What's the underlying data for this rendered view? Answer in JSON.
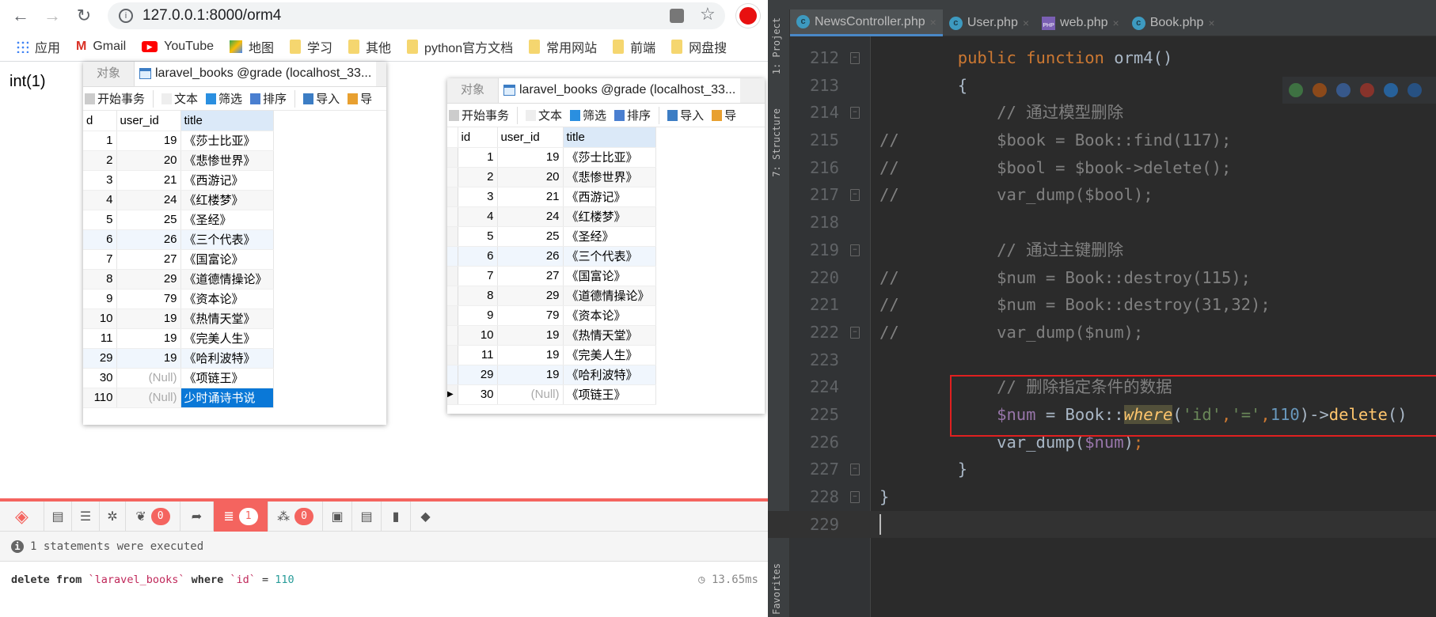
{
  "browser": {
    "url": "127.0.0.1:8000/orm4",
    "bookmarks": [
      "应用",
      "Gmail",
      "YouTube",
      "地图",
      "学习",
      "其他",
      "python官方文档",
      "常用网站",
      "前端",
      "网盘搜"
    ],
    "page_output": "int(1)"
  },
  "navicat_before": {
    "tab_objects": "对象",
    "tab_table": "laravel_books @grade (localhost_33...",
    "tools": {
      "begin": "开始事务",
      "text": "文本",
      "filter": "筛选",
      "sort": "排序",
      "import": "导入",
      "export": "导"
    },
    "columns": [
      "d",
      "user_id",
      "title"
    ],
    "rows": [
      [
        "1",
        "19",
        "《莎士比亚》"
      ],
      [
        "2",
        "20",
        "《悲惨世界》"
      ],
      [
        "3",
        "21",
        "《西游记》"
      ],
      [
        "4",
        "24",
        "《红楼梦》"
      ],
      [
        "5",
        "25",
        "《圣经》"
      ],
      [
        "6",
        "26",
        "《三个代表》"
      ],
      [
        "7",
        "27",
        "《国富论》"
      ],
      [
        "8",
        "29",
        "《道德情操论》"
      ],
      [
        "9",
        "79",
        "《资本论》"
      ],
      [
        "10",
        "19",
        "《热情天堂》"
      ],
      [
        "11",
        "19",
        "《完美人生》"
      ],
      [
        "29",
        "19",
        "《哈利波特》"
      ],
      [
        "30",
        "(Null)",
        "《项链王》"
      ],
      [
        "110",
        "(Null)",
        "少时诵诗书说"
      ]
    ]
  },
  "navicat_after": {
    "tab_objects": "对象",
    "tab_table": "laravel_books @grade (localhost_33...",
    "tools": {
      "begin": "开始事务",
      "text": "文本",
      "filter": "筛选",
      "sort": "排序",
      "import": "导入",
      "export": "导"
    },
    "columns": [
      "id",
      "user_id",
      "title"
    ],
    "rows": [
      [
        "1",
        "19",
        "《莎士比亚》"
      ],
      [
        "2",
        "20",
        "《悲惨世界》"
      ],
      [
        "3",
        "21",
        "《西游记》"
      ],
      [
        "4",
        "24",
        "《红楼梦》"
      ],
      [
        "5",
        "25",
        "《圣经》"
      ],
      [
        "6",
        "26",
        "《三个代表》"
      ],
      [
        "7",
        "27",
        "《国富论》"
      ],
      [
        "8",
        "29",
        "《道德情操论》"
      ],
      [
        "9",
        "79",
        "《资本论》"
      ],
      [
        "10",
        "19",
        "《热情天堂》"
      ],
      [
        "11",
        "19",
        "《完美人生》"
      ],
      [
        "29",
        "19",
        "《哈利波特》"
      ],
      [
        "30",
        "(Null)",
        "《项链王》"
      ]
    ]
  },
  "debugbar": {
    "badges": {
      "messages": "0",
      "queries": "1",
      "models": "0"
    },
    "status": "1 statements were executed",
    "query": {
      "kw1": "delete from ",
      "table": "`laravel_books`",
      "kw2": " where ",
      "col": "`id`",
      "op": " = ",
      "val": "110"
    },
    "time": "13.65ms",
    "accent": "#f4645f"
  },
  "ide": {
    "side_labels": [
      "1: Project",
      "7: Structure",
      "Favorites"
    ],
    "tabs": [
      "NewsController.php",
      "User.php",
      "web.php",
      "Book.php"
    ],
    "lines": [
      {
        "n": "212",
        "tokens": [
          [
            "        ",
            "d"
          ],
          [
            "public ",
            "k"
          ],
          [
            "function ",
            "k"
          ],
          [
            "orm4",
            "fn"
          ],
          [
            "()",
            "d"
          ]
        ]
      },
      {
        "n": "213",
        "tokens": [
          [
            "        {",
            "d"
          ]
        ]
      },
      {
        "n": "214",
        "tokens": [
          [
            "            // 通过模型删除",
            "c"
          ]
        ]
      },
      {
        "n": "215",
        "tokens": [
          [
            "//          $book = Book::find(117);",
            "c"
          ]
        ]
      },
      {
        "n": "216",
        "tokens": [
          [
            "//          $bool = $book->delete();",
            "c"
          ]
        ]
      },
      {
        "n": "217",
        "tokens": [
          [
            "//          var_dump($bool);",
            "c"
          ]
        ]
      },
      {
        "n": "218",
        "tokens": []
      },
      {
        "n": "219",
        "tokens": [
          [
            "            // 通过主键删除",
            "c"
          ]
        ]
      },
      {
        "n": "220",
        "tokens": [
          [
            "//          $num = Book::destroy(115);",
            "c"
          ]
        ]
      },
      {
        "n": "221",
        "tokens": [
          [
            "//          $num = Book::destroy(31,32);",
            "c"
          ]
        ]
      },
      {
        "n": "222",
        "tokens": [
          [
            "//          var_dump($num);",
            "c"
          ]
        ]
      },
      {
        "n": "223",
        "tokens": []
      },
      {
        "n": "224",
        "tokens": [
          [
            "            // 删除指定条件的数据",
            "c"
          ]
        ]
      },
      {
        "n": "225",
        "tokens": [
          [
            "            ",
            "d"
          ],
          [
            "$num",
            "v"
          ],
          [
            " = Book::",
            "d"
          ],
          [
            "where",
            "hl-w"
          ],
          [
            "(",
            "d"
          ],
          [
            "'id'",
            "s"
          ],
          [
            ",",
            "k"
          ],
          [
            "'='",
            "s"
          ],
          [
            ",",
            "k"
          ],
          [
            "110",
            "n"
          ],
          [
            ")->",
            "d"
          ],
          [
            "delete",
            "f"
          ],
          [
            "()",
            "d"
          ]
        ]
      },
      {
        "n": "226",
        "tokens": [
          [
            "            var_dump(",
            "d"
          ],
          [
            "$num",
            "v"
          ],
          [
            ")",
            "d"
          ],
          [
            ";",
            "k"
          ]
        ]
      },
      {
        "n": "227",
        "tokens": [
          [
            "        }",
            "d"
          ]
        ]
      },
      {
        "n": "228",
        "tokens": [
          [
            "}",
            "d"
          ]
        ]
      },
      {
        "n": "229",
        "tokens": []
      }
    ]
  }
}
